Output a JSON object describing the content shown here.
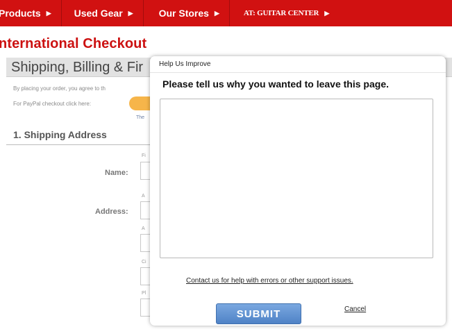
{
  "nav": {
    "items": [
      {
        "label": "Products"
      },
      {
        "label": "Used Gear"
      },
      {
        "label": "Our Stores"
      },
      {
        "label": "AT: GUITAR CENTER"
      }
    ],
    "arrow_icon": "triangle-right-icon",
    "bg_color": "#d11111"
  },
  "page": {
    "title": "nternational Checkout",
    "section_title": "Shipping, Billing & Fir",
    "terms_text": "By placing your order, you agree to th",
    "paypal_text": "For PayPal checkout click here:",
    "paypal_sub": "The",
    "shipping_heading": "1. Shipping Address",
    "name_label": "Name:",
    "address_label": "Address:",
    "mini_labels": [
      "Fi",
      "A",
      "A",
      "Ci",
      "Pl"
    ]
  },
  "modal": {
    "header_title": "Help Us Improve",
    "question": "Please tell us why you wanted to leave this page.",
    "feedback_value": "",
    "contact_link": "Contact us for help with errors or other support issues.",
    "submit_label": "SUBMIT",
    "cancel_label": "Cancel",
    "submit_color": "#5a8ccf"
  }
}
